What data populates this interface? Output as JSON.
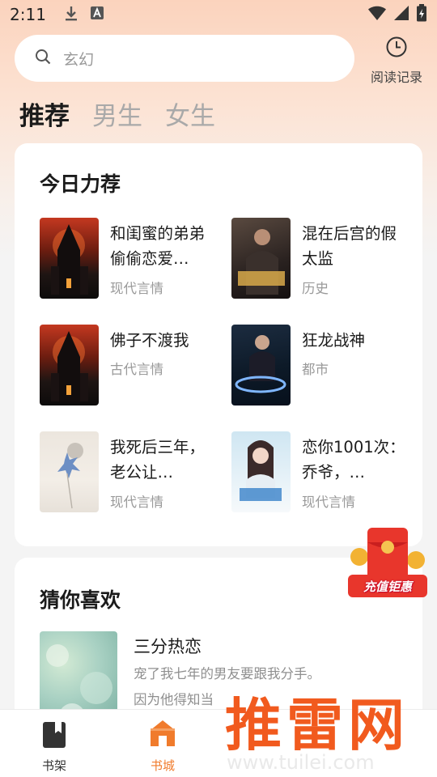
{
  "status": {
    "time": "2:11"
  },
  "search": {
    "placeholder": "玄幻"
  },
  "history": {
    "label": "阅读记录"
  },
  "tabs": [
    {
      "label": "推荐",
      "active": true
    },
    {
      "label": "男生",
      "active": false
    },
    {
      "label": "女生",
      "active": false
    }
  ],
  "today": {
    "title": "今日力荐",
    "books": [
      {
        "title": "和闺蜜的弟弟偷偷恋爱…",
        "genre": "现代言情"
      },
      {
        "title": "混在后宫的假太监",
        "genre": "历史"
      },
      {
        "title": "佛子不渡我",
        "genre": "古代言情"
      },
      {
        "title": "狂龙战神",
        "genre": "都市"
      },
      {
        "title": "我死后三年，老公让…",
        "genre": "现代言情"
      },
      {
        "title": "恋你1001次：乔爷，…",
        "genre": "现代言情"
      }
    ]
  },
  "guess": {
    "title": "猜你喜欢",
    "book": {
      "title": "三分热恋",
      "desc1": "宠了我七年的男友要跟我分手。",
      "desc2": "因为他得知当"
    }
  },
  "promo": {
    "label": "充值钜惠"
  },
  "nav": [
    {
      "label": "书架",
      "active": false
    },
    {
      "label": "书城",
      "active": true
    }
  ],
  "watermark": {
    "brand": "推雷网",
    "url": "www.tuilei.com"
  },
  "colors": {
    "accent": "#f07b2c",
    "watermark": "#f15a1e"
  }
}
